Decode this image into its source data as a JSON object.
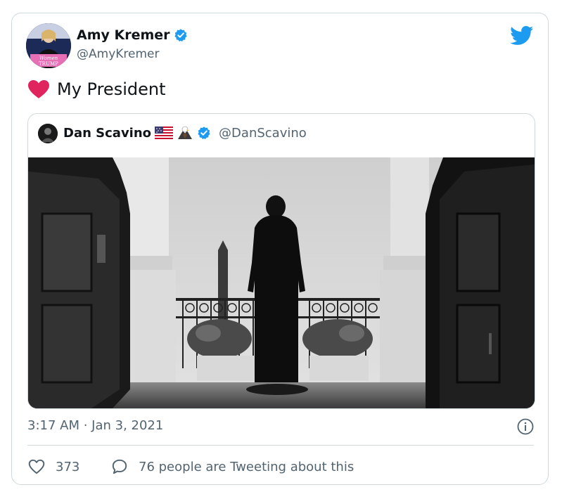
{
  "author": {
    "name": "Amy Kremer",
    "handle": "@AmyKremer",
    "verified": true,
    "avatar_caption_line1": "Women",
    "avatar_caption_line2": "TRUMP"
  },
  "tweet": {
    "emoji": "heart",
    "text": "My President"
  },
  "quoted_tweet": {
    "name": "Dan Scavino",
    "name_emojis": [
      "us-flag",
      "eagle"
    ],
    "handle": "@DanScavino",
    "verified": true
  },
  "timestamp": "3:17 AM · Jan 3, 2021",
  "actions": {
    "likes": "373",
    "conversation_label": "76 people are Tweeting about this"
  },
  "colors": {
    "twitter_blue": "#1d9bf0",
    "heart_red": "#e0245e",
    "secondary_text": "#536471",
    "border": "#cfd9de"
  }
}
